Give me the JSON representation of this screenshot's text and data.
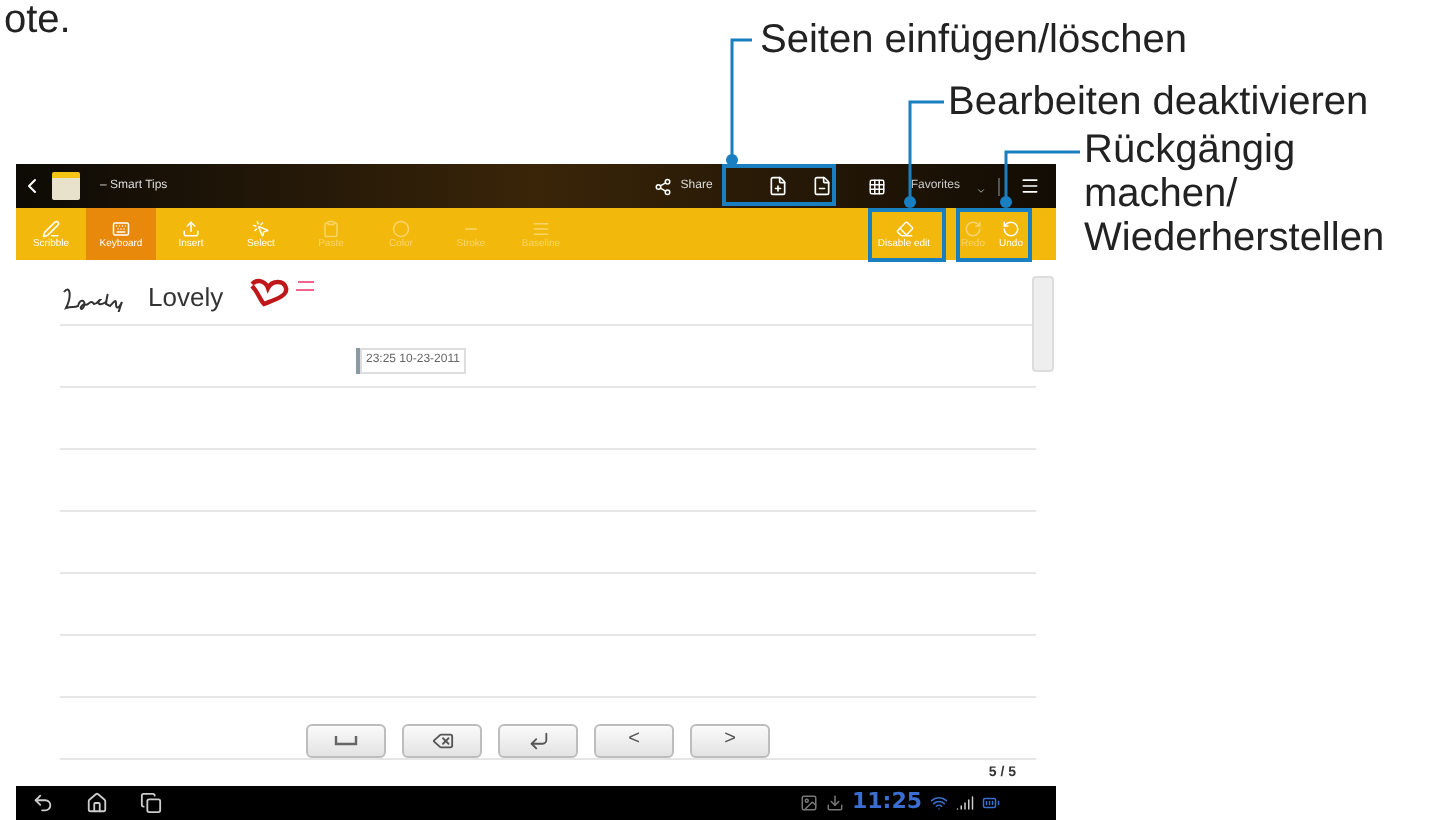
{
  "page_fragment": "ote.",
  "callouts": [
    {
      "text": "Seiten einfügen/löschen"
    },
    {
      "text": "Bearbeiten deaktivieren"
    },
    {
      "text": "Rückgängig machen/ Wiederherstellen"
    }
  ],
  "app_bar": {
    "title": "– Smart Tips",
    "share": "Share",
    "favorites": "Favorites"
  },
  "toolbar": [
    {
      "label": "Scribble",
      "selected": false,
      "disabled": false
    },
    {
      "label": "Keyboard",
      "selected": true,
      "disabled": false
    },
    {
      "label": "Insert",
      "selected": false,
      "disabled": false
    },
    {
      "label": "Select",
      "selected": false,
      "disabled": false
    },
    {
      "label": "Paste",
      "selected": false,
      "disabled": true
    },
    {
      "label": "Color",
      "selected": false,
      "disabled": true
    },
    {
      "label": "Stroke",
      "selected": false,
      "disabled": true
    },
    {
      "label": "Baseline",
      "selected": false,
      "disabled": true
    }
  ],
  "toolbar_right": [
    {
      "label": "Disable edit",
      "disabled": false
    },
    {
      "label": "Redo",
      "disabled": true
    },
    {
      "label": "Undo",
      "disabled": false
    }
  ],
  "note": {
    "typed_word": "Lovely",
    "timestamp": "23:25 10-23-2011"
  },
  "keys": [
    {
      "kind": "space"
    },
    {
      "kind": "backspace"
    },
    {
      "kind": "enter"
    },
    {
      "kind": "char",
      "label": "<"
    },
    {
      "kind": "char",
      "label": ">"
    }
  ],
  "page_count": "5 / 5",
  "status_bar": {
    "time": "11:25"
  }
}
